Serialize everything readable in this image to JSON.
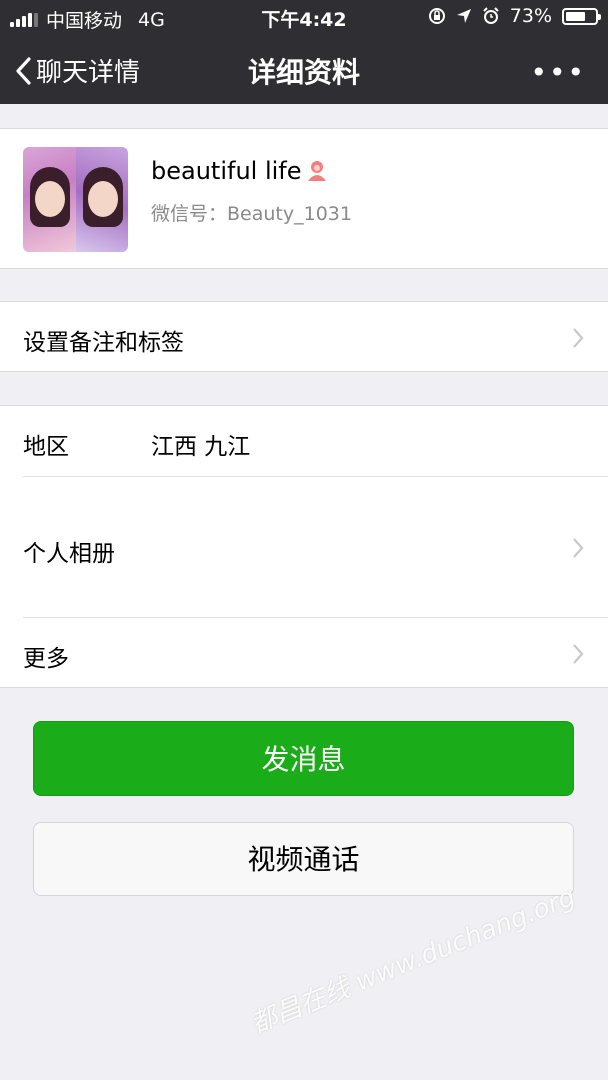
{
  "status_bar": {
    "carrier": "中国移动",
    "network": "4G",
    "time": "下午4:42",
    "battery_percent": "73%",
    "battery_level": 0.73
  },
  "nav": {
    "back_label": "聊天详情",
    "title": "详细资料",
    "more_icon": "•••"
  },
  "profile": {
    "name": "beautiful life",
    "wechat_id": "微信号：Beauty_1031",
    "gender_icon": "female-icon",
    "gender_color": "#f37e7d"
  },
  "rows": {
    "remark_label": "设置备注和标签",
    "region_label": "地区",
    "region_value": "江西 九江",
    "album_label": "个人相册",
    "more_label": "更多"
  },
  "buttons": {
    "send_message": "发消息",
    "video_call": "视频通话"
  },
  "watermark": {
    "text": "都昌在线 www.duchang.org"
  },
  "colors": {
    "nav_bg": "#2e2e33",
    "primary_green": "#1aad19",
    "page_bg": "#efeff4"
  }
}
